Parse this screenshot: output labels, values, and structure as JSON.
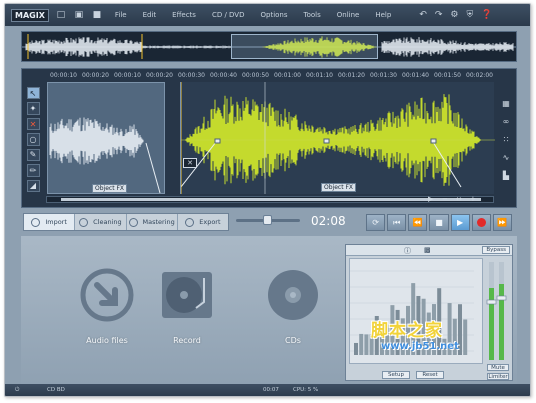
{
  "app": {
    "logo": "MAGIX"
  },
  "menu": [
    "File",
    "Edit",
    "Effects",
    "CD / DVD",
    "Options",
    "Tools",
    "Online",
    "Help"
  ],
  "editor": {
    "ruler_ticks": [
      "00:00:10",
      "00:00:20",
      "00:00:10",
      "00:00:20",
      "00:00:30",
      "00:00:40",
      "00:00:50",
      "00:01:00",
      "00:01:10",
      "00:01:20",
      "00:01:30",
      "00:01:40",
      "00:01:50",
      "00:02:00"
    ],
    "object_fx_left": "Object FX",
    "object_fx_right": "Object FX"
  },
  "tabs": [
    {
      "label": "Import",
      "active": true
    },
    {
      "label": "Cleaning",
      "active": false
    },
    {
      "label": "Mastering",
      "active": false
    },
    {
      "label": "Export",
      "active": false
    }
  ],
  "transport": {
    "time": "02:08",
    "volume_level": 0.45
  },
  "sources": [
    {
      "label": "Audio files",
      "icon": "import-arrow-icon"
    },
    {
      "label": "Record",
      "icon": "turntable-icon"
    },
    {
      "label": "CDs",
      "icon": "cd-icon"
    }
  ],
  "mixer": {
    "bypass": "Bypass",
    "setup": "Setup",
    "reset": "Reset",
    "mute": "Mute",
    "limiter": "Limiter"
  },
  "status": {
    "cd": "CD BD",
    "time_left": "00:07",
    "cpu": "CPU: 5 %"
  },
  "watermark": {
    "line1": "脚本之家",
    "line2": "www.jb51.net"
  },
  "colors": {
    "waveform_selected": "#d6ec2a",
    "waveform_normal": "#e8eef4",
    "accent": "#5b9bd2",
    "record": "#e22a2a"
  }
}
